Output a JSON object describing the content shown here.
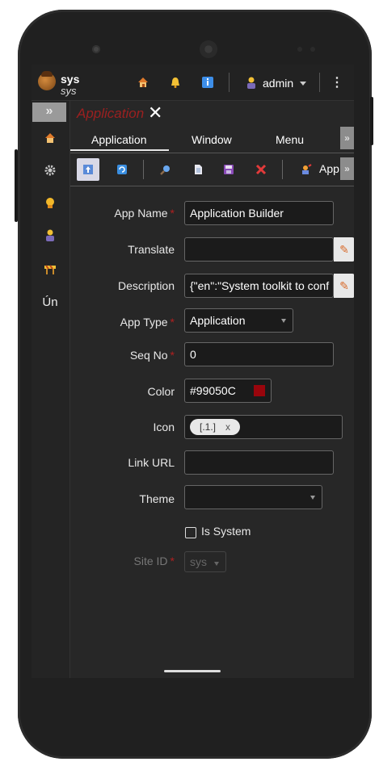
{
  "topbar": {
    "brand_line1": "sys",
    "brand_line2": "sys",
    "user_name": "admin",
    "icons": [
      "home-icon",
      "bell-icon",
      "info-icon",
      "user-icon",
      "more-vert-icon"
    ]
  },
  "sidebar": {
    "toggle": "»",
    "items": [
      {
        "icon": "home-icon"
      },
      {
        "icon": "gear-icon"
      },
      {
        "icon": "badge-icon"
      },
      {
        "icon": "user-icon"
      },
      {
        "icon": "barrier-icon"
      },
      {
        "text": "Ún"
      }
    ]
  },
  "page": {
    "title": "Application",
    "tabs": [
      "Application",
      "Window",
      "Menu"
    ],
    "active_tab": "Application",
    "scroll_label": "»",
    "toolbar_link": "App"
  },
  "form": {
    "app_name": {
      "label": "App Name",
      "value": "Application Builder",
      "required": true
    },
    "translate": {
      "label": "Translate",
      "value": ""
    },
    "description": {
      "label": "Description",
      "value": "{\"en\":\"System toolkit to conf"
    },
    "app_type": {
      "label": "App Type",
      "value": "Application",
      "required": true
    },
    "seq_no": {
      "label": "Seq No",
      "value": "0",
      "required": true
    },
    "color": {
      "label": "Color",
      "value": "#99050C",
      "swatch": "#99050C"
    },
    "icon": {
      "label": "Icon",
      "chip": "[.1.]",
      "chip_remove": "x"
    },
    "link_url": {
      "label": "Link URL",
      "value": ""
    },
    "theme": {
      "label": "Theme",
      "value": ""
    },
    "is_system": {
      "label": "Is System",
      "checked": false
    },
    "site_id": {
      "label": "Site ID",
      "value": "sys",
      "required": true
    }
  },
  "colors": {
    "accent": "#9b2020",
    "background": "#272727"
  }
}
